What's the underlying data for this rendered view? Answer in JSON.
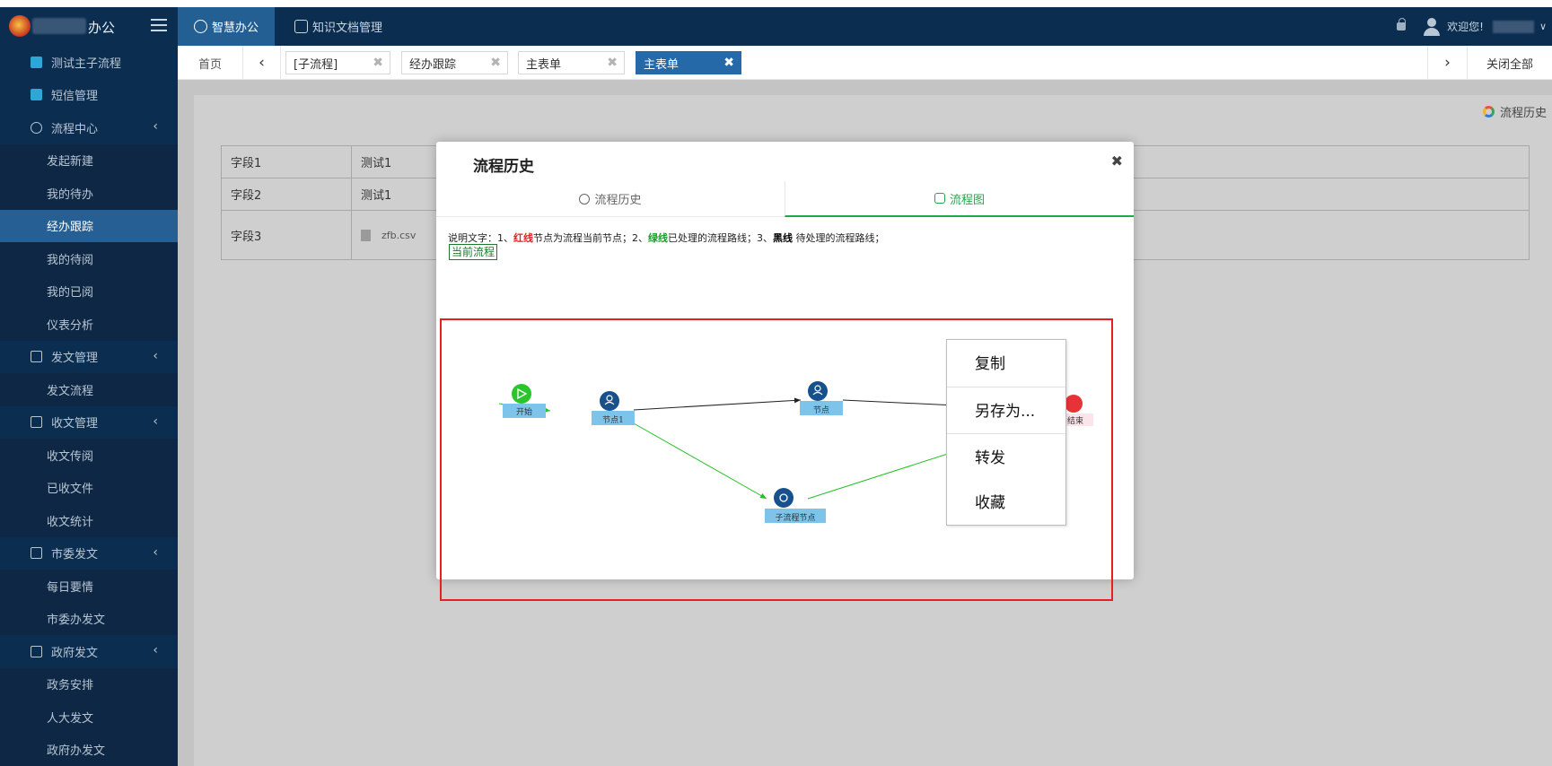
{
  "header": {
    "logo_text": "办公",
    "nav_tabs": [
      {
        "label": "智慧办公",
        "icon": "recycle-icon"
      },
      {
        "label": "知识文档管理",
        "icon": "document-icon"
      }
    ],
    "welcome": "欢迎您!"
  },
  "sidebar": {
    "items": [
      {
        "label": "测试主子流程"
      },
      {
        "label": "短信管理"
      },
      {
        "label": "流程中心"
      },
      {
        "label": "发起新建"
      },
      {
        "label": "我的待办"
      },
      {
        "label": "经办跟踪"
      },
      {
        "label": "我的待阅"
      },
      {
        "label": "我的已阅"
      },
      {
        "label": "仪表分析"
      },
      {
        "label": "发文管理"
      },
      {
        "label": "发文流程"
      },
      {
        "label": "收文管理"
      },
      {
        "label": "收文传阅"
      },
      {
        "label": "已收文件"
      },
      {
        "label": "收文统计"
      },
      {
        "label": "市委发文"
      },
      {
        "label": "每日要情"
      },
      {
        "label": "市委办发文"
      },
      {
        "label": "政府发文"
      },
      {
        "label": "政务安排"
      },
      {
        "label": "人大发文"
      },
      {
        "label": "政府办发文"
      }
    ]
  },
  "tabbar": {
    "home": "首页",
    "tabs": [
      "[子流程]",
      "经办跟踪",
      "主表单",
      "主表单"
    ],
    "close_all": "关闭全部"
  },
  "content": {
    "history_link": "流程历史",
    "rows": [
      {
        "label": "字段1",
        "value": "测试1"
      },
      {
        "label": "字段2",
        "value": "测试1"
      },
      {
        "label": "字段3",
        "value": "zfb.csv"
      }
    ]
  },
  "modal": {
    "title": "流程历史",
    "tabs": [
      "流程历史",
      "流程图"
    ],
    "legend": {
      "p1": "说明文字：1、",
      "red": "红线",
      "p2": "节点为流程当前节点；2、",
      "green": "绿线",
      "p3": "已处理的流程路线；3、",
      "black": "黑线",
      "p4": " 待处理的流程路线；"
    },
    "current_flow": "当前流程"
  },
  "flow": {
    "nodes": [
      "开始",
      "节点1",
      "节点",
      "结束",
      "子流程节点"
    ]
  },
  "context_menu": {
    "items": [
      "复制",
      "另存为...",
      "转发",
      "收藏"
    ]
  },
  "colors": {
    "sidebar_bg": "#0b2d4f",
    "active_blue": "#2569a8",
    "accent_green": "#1faa4a",
    "highlight_red": "#e62020"
  }
}
